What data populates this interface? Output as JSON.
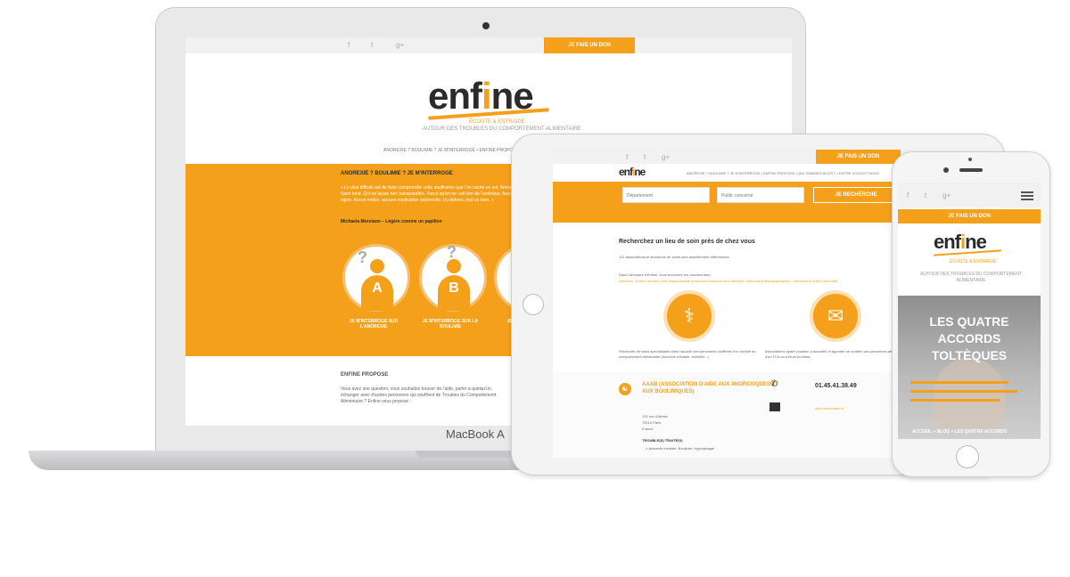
{
  "colors": {
    "accent": "#f5a01a",
    "dark": "#2b2b2b"
  },
  "laptop": {
    "brand": "MacBook A",
    "social_icons": [
      "facebook-icon",
      "twitter-icon",
      "googleplus-icon"
    ],
    "social_glyphs": [
      "f",
      "t",
      "g+"
    ],
    "donate_label": "JE FAIS UN DON",
    "logo": {
      "before": "enf",
      "i": "i",
      "after": "ne"
    },
    "tagline": "ÉCOUTE & ENTRAIDE",
    "subtagline": "AUTOUR DES TROUBLES DU COMPORTEMENT ALIMENTAIRE",
    "nav": "ANOREXIE ? BOULIMIE ? JE M'INTERROGE  •  ENFINE PROPOSE  •  Q",
    "band_title": "ANOREXIE ? BOULIMIE ? JE M'INTERROGE",
    "quote": "« Le plus difficile est de faire comprendre cette souffrance que l'on cache en soi. Anorexie, Sans fond. Qui ne laisse rien transparaître. Parce qu'on ne voit rien de l'extérieur. Aucun signe. Aucun indice, aucune explication rationnelle. Du dehors, tout va bien. »",
    "quote_author": "Michaela Morsiano – Légère comme un papillon",
    "circles": [
      {
        "letter": "A",
        "label": "JE M'INTERROGE SUR L'ANOREXIE"
      },
      {
        "letter": "B",
        "label": "JE M'INTERROGE SUR LA BOULIMIE"
      },
      {
        "letter": "",
        "label": "JE M'INTERROGE"
      }
    ],
    "propose_title": "ENFINE PROPOSE",
    "propose_text": "Vous avez une question, vous souhaitez trouver de l'aide, parler à quelqu'un, échanger avec d'autres personnes qui souffrent de Troubles du Comportement Alimentaire ? Enfine vous propose :"
  },
  "tablet": {
    "donate_label": "JE FAIS UN DON",
    "nav": "ANOREXIE ? BOULIMIE ? JE M'INTERROGE  •  ENFINE PROPOSE  •  QUI SOMMES-NOUS ?  •  ENTRE VOUS ET NOUS",
    "select_department": "Département",
    "select_public": "Public concerné",
    "search_button": "JE RECHERCHE",
    "title": "Recherchez un lieu de soin près de chez vous",
    "count_text": "141 associations et structures de soins sont actuellement référencées",
    "intro_line1": "Dans l'annuaire d'Enfine, vous trouverez les coordonnées :",
    "intro_line2": "Attention : Enfine décline toute responsabilité quant aux contenus des sites liés, références bibliographiques... mentionnés à titre informatif",
    "col1_text": "Structures de soins spécialisées dans l'accueil des personnes souffrant d'un trouble du comportement alimentaire (anorexie mentale, boulimie...)",
    "col2_text": "Associations ayant vocation à accueillir et apporter un soutien aux personnes atteintes d'un TCA ou à leurs proches.",
    "entry": {
      "name": "AAAB (ASSOCIATION D'AIDE AUX ANOREXIQUES ET AUX BOULIMIQUES)",
      "addr1": "131 rue d'Alésia",
      "addr2": "75014 Paris",
      "addr3": "France",
      "phone": "01.45.41.38.49",
      "url": "http://www.aaab.fr",
      "troubles_label": "TROUBLE(S) TRAITÉ(S)",
      "troubles": "Anorexie mentale, Boulimie, Hyperphagie"
    }
  },
  "phone": {
    "donate_label": "JE FAIS UN DON",
    "tagline": "ÉCOUTE & ENTRAIDE",
    "subtagline": "AUTOUR DES TROUBLES DU COMPORTEMENT ALIMENTAIRE",
    "hero_title": "LES QUATRE ACCORDS TOLTÈQUES",
    "breadcrumb": "ACCUEIL  »  BLOG  »  LES QUATRE ACCORDS"
  }
}
